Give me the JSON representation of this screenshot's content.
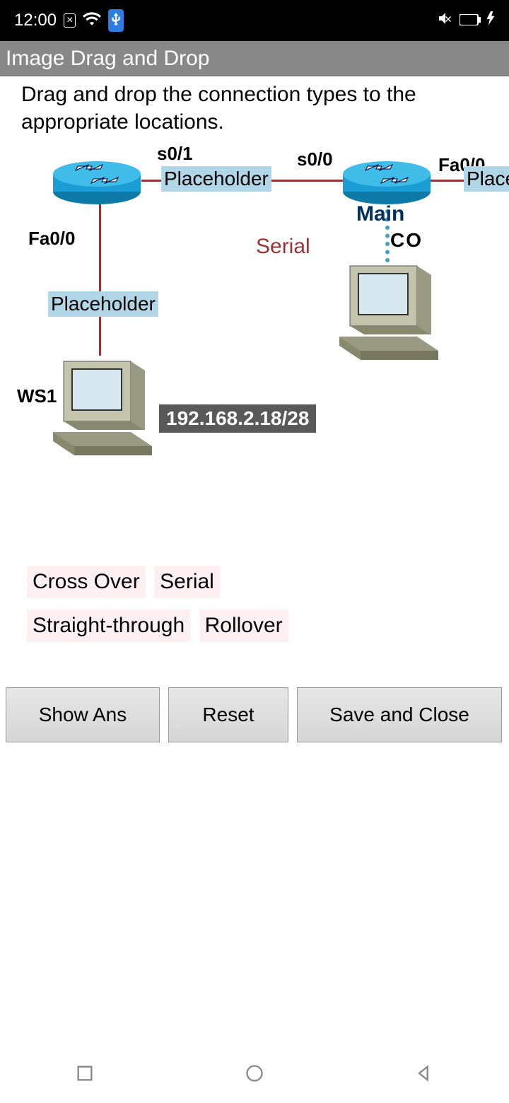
{
  "status": {
    "time": "12:00"
  },
  "app": {
    "title": "Image Drag and Drop"
  },
  "instruction": "Drag and drop the connection types to the appropriate locations.",
  "diagram": {
    "ports": {
      "s01": "s0/1",
      "s00": "s0/0",
      "fa00_right": "Fa0/0",
      "fa00_left": "Fa0/0"
    },
    "labels": {
      "main": "Main",
      "co": "CO",
      "ws1": "WS1",
      "serial": "Serial"
    },
    "placeholders": {
      "ph1": "Placeholder",
      "ph2": "Placeholder",
      "ph3": "Placeholder"
    },
    "ip": "192.168.2.18/28"
  },
  "drag_items": [
    "Cross Over",
    "Serial",
    "Straight-through",
    "Rollover"
  ],
  "buttons": {
    "show": "Show Ans",
    "reset": "Reset",
    "save": "Save and Close"
  }
}
